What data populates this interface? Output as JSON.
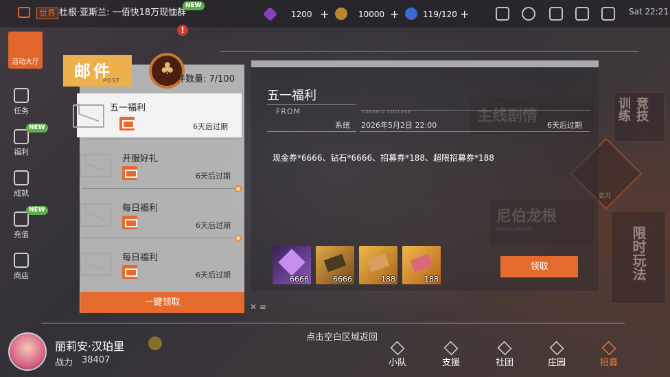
{
  "topbar": {
    "world_tag": "世界",
    "world_message": "杜根·亚斯兰: 一佰快18万现恤群",
    "new_badge": "NEW",
    "diamonds": "1200",
    "coins": "10000",
    "stamina": "119/120",
    "clock": "Sat 22:21"
  },
  "sidebar": {
    "items": [
      {
        "label": "活动大厅",
        "icon": "event-hall-icon"
      },
      {
        "label": "任务",
        "icon": "task-icon"
      },
      {
        "label": "福利",
        "icon": "welfare-icon",
        "badge": "NEW"
      },
      {
        "label": "成就",
        "icon": "achievement-icon"
      },
      {
        "label": "充值",
        "icon": "recharge-icon",
        "badge": "NEW"
      },
      {
        "label": "商店",
        "icon": "shop-icon"
      }
    ]
  },
  "mail": {
    "title": "邮件",
    "subtitle": "POST",
    "count": "件数量: 7/100",
    "items": [
      {
        "title": "五一福利",
        "expire": "6天后过期",
        "selected": true,
        "unread": false
      },
      {
        "title": "开服好礼",
        "expire": "6天后过期",
        "selected": false,
        "unread": false
      },
      {
        "title": "每日福利",
        "expire": "6天后过期",
        "selected": false,
        "unread": true
      },
      {
        "title": "每日福利",
        "expire": "6天后过期",
        "selected": false,
        "unread": true
      }
    ],
    "claim_all": "一键领取"
  },
  "detail": {
    "title": "五一福利",
    "from_label": "FROM",
    "sender": "系统",
    "school": "CASSELL COLLEGE",
    "date": "2026年5月2日 22:00",
    "expire": "6天后过期",
    "content": "现金券*6666、钻石*6666、招募券*188、超限招募券*188",
    "rewards": [
      {
        "name": "diamond",
        "qty": "6666",
        "color": "#6d3fa8"
      },
      {
        "name": "cash-voucher",
        "qty": "6666",
        "color": "#9c7a2e"
      },
      {
        "name": "recruit-ticket",
        "qty": "188",
        "color": "#b58a2f"
      },
      {
        "name": "super-recruit-ticket",
        "qty": "188",
        "color": "#c25a6a"
      }
    ],
    "claim": "领取"
  },
  "right_deco": {
    "training": "竞技 训练",
    "limited": "限时玩法",
    "main_story": "主线剧情",
    "nibelungen": "尼伯龙根",
    "nibelungen_en": "NIBELUNGEN",
    "see": "见习"
  },
  "hint": "点击空白区域返回",
  "player": {
    "name": "丽莉安·汉珀里",
    "power_label": "战力",
    "power": "38407"
  },
  "nav": [
    {
      "label": "小队"
    },
    {
      "label": "支援"
    },
    {
      "label": "社团"
    },
    {
      "label": "庄园"
    },
    {
      "label": "招募",
      "active": true
    }
  ]
}
